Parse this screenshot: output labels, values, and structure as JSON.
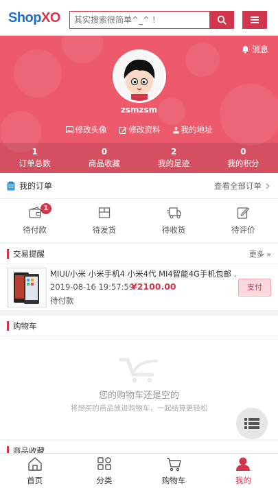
{
  "header": {
    "logo_part1": "Shop",
    "logo_part2": "XO",
    "search_placeholder": "其实搜索很简单^_^ !",
    "search_icon": "search-icon",
    "menu_icon": "menu-icon"
  },
  "profile": {
    "message_label": "消息",
    "username": "zsmzsm",
    "actions": [
      {
        "label": "修改头像",
        "icon": "image-icon"
      },
      {
        "label": "修改资料",
        "icon": "edit-icon"
      },
      {
        "label": "我的地址",
        "icon": "location-icon"
      }
    ],
    "stats": [
      {
        "value": "1",
        "label": "订单总数"
      },
      {
        "value": "0",
        "label": "商品收藏"
      },
      {
        "value": "2",
        "label": "我的足迹"
      },
      {
        "value": "0",
        "label": "我的积分"
      }
    ]
  },
  "orders": {
    "title": "我的订单",
    "view_all": "查看全部订单",
    "tabs": [
      {
        "label": "待付款",
        "badge": "1",
        "icon": "wallet-icon"
      },
      {
        "label": "待发货",
        "icon": "package-icon"
      },
      {
        "label": "待收货",
        "icon": "truck-icon"
      },
      {
        "label": "待评价",
        "icon": "review-icon"
      }
    ]
  },
  "trade": {
    "title": "交易提醒",
    "more": "更多 »",
    "item": {
      "name": "MIUI/小米 小米手机4 小米4代 MI4智能4G手机包邮 ...",
      "date": "2019-08-16 19:57:59",
      "price": "¥2100.00",
      "status": "待付款",
      "pay_button": "支付"
    }
  },
  "cart": {
    "title": "购物车",
    "empty_title": "您的购物车还是空的",
    "empty_sub": "将想买的商品放进购物车，一起结算更轻松"
  },
  "favorites": {
    "title": "商品收藏"
  },
  "bottom_nav": [
    {
      "label": "首页",
      "icon": "home-icon",
      "active": false
    },
    {
      "label": "分类",
      "icon": "category-icon",
      "active": false
    },
    {
      "label": "购物车",
      "icon": "cart-icon",
      "active": false
    },
    {
      "label": "我的",
      "icon": "user-icon",
      "active": true
    }
  ],
  "colors": {
    "brand_red": "#d2364c",
    "hero_bg": "#ec5a6c",
    "logo_blue": "#1a6fd1"
  }
}
